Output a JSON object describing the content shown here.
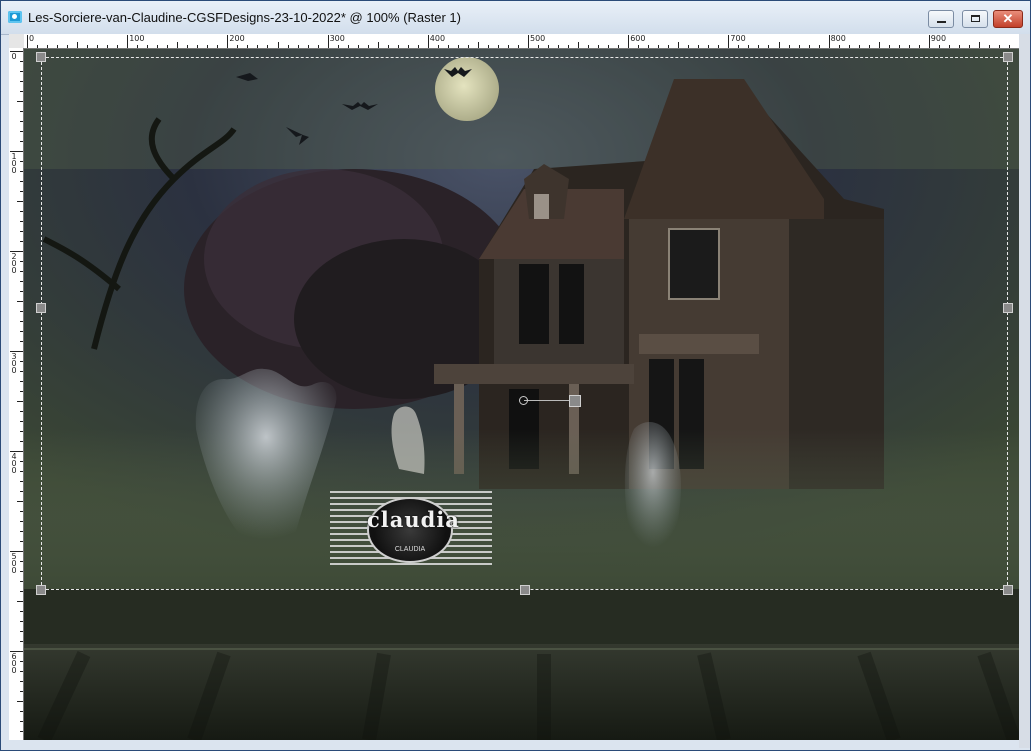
{
  "window": {
    "title": "Les-Sorciere-van-Claudine-CGSFDesigns-23-10-2022* @ 100% (Raster 1)",
    "minimize": "minimize",
    "maximize": "maximize",
    "close": "✕"
  },
  "ruler": {
    "h_labels": [
      "0",
      "100",
      "200",
      "300",
      "400",
      "500",
      "600",
      "700",
      "800",
      "900"
    ],
    "v_labels": [
      "0",
      "100",
      "200",
      "300",
      "400",
      "500",
      "600"
    ]
  },
  "image": {
    "watermark": "claudia",
    "watermark_sub": "CLAUDIA"
  },
  "colors": {
    "sky": "#2d3646",
    "fog": "#5d6b52",
    "ground": "#1d2219",
    "moon": "#cfcfa8"
  }
}
